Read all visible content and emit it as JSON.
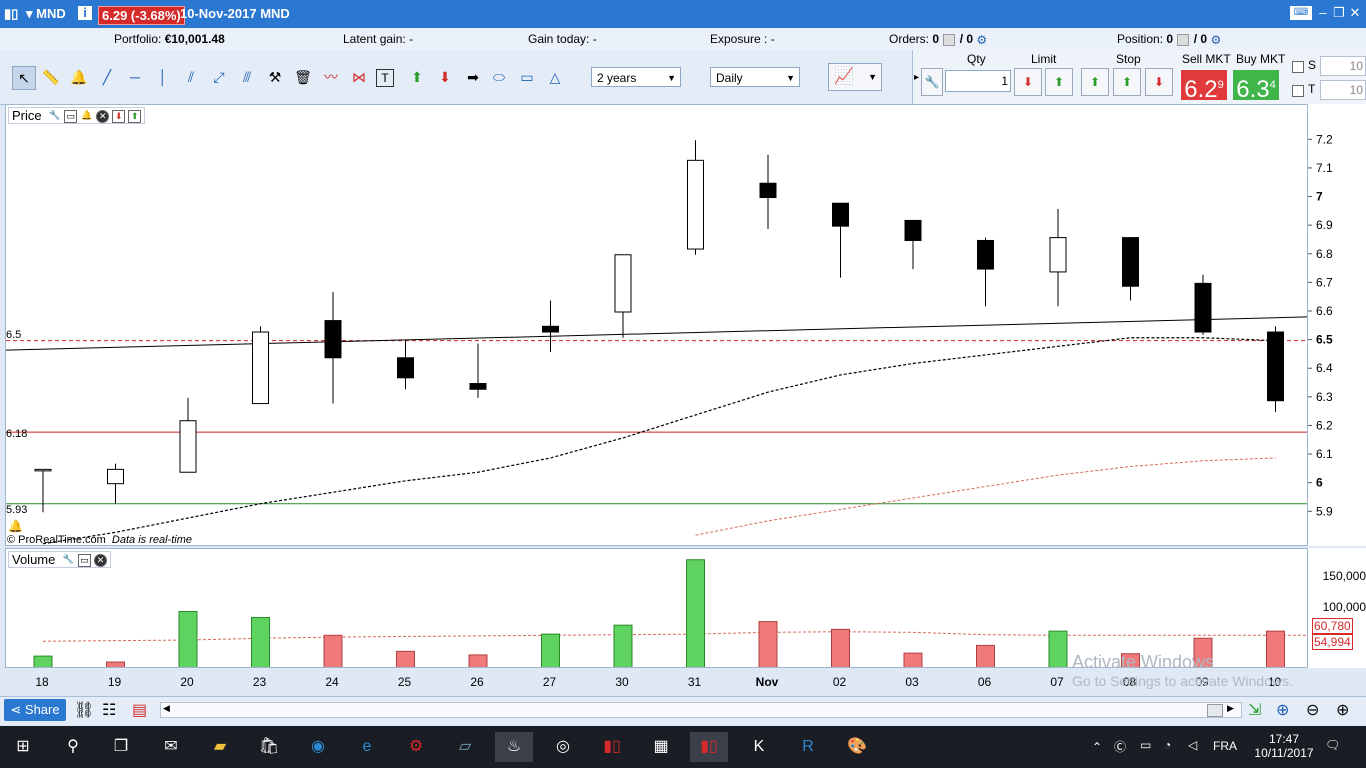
{
  "title_bar": {
    "symbol": "MND",
    "price_change": "6.29 (-3.68%)",
    "date_symbol": "10-Nov-2017 MND"
  },
  "portfolio_row": {
    "portfolio_label": "Portfolio:",
    "portfolio_value": "€10,001.48",
    "latent_label": "Latent gain:",
    "latent_value": "-",
    "today_label": "Gain today:",
    "today_value": "-",
    "exposure_label": "Exposure :",
    "exposure_value": "-",
    "orders_label": "Orders:",
    "orders_value": "0",
    "orders_value2": "/ 0",
    "position_label": "Position:",
    "position_value": "0",
    "position_value2": "/ 0"
  },
  "toolbar": {
    "period": "2 years",
    "interval": "Daily"
  },
  "trade_panel": {
    "qty_label": "Qty",
    "qty_value": "1",
    "limit_label": "Limit",
    "stop_label": "Stop",
    "sell_label": "Sell MKT",
    "sell_price": "6.2",
    "sell_sup": "9",
    "buy_label": "Buy MKT",
    "buy_price": "6.3",
    "buy_sup": "4",
    "s_label": "S",
    "s_value": "10",
    "t_label": "T",
    "t_value": "10"
  },
  "price_panel": {
    "title": "Price",
    "label_65": "6.5",
    "label_618": "6.18",
    "label_593": "5.93",
    "credit": "© ProRealTime.com",
    "realtime": "Data is real-time",
    "axis_ticks": [
      "7.2",
      "7.1",
      "7",
      "6.9",
      "6.8",
      "6.7",
      "6.6",
      "6.5",
      "6.4",
      "6.3",
      "6.2",
      "6.1",
      "6",
      "5.9"
    ]
  },
  "volume_panel": {
    "title": "Volume",
    "axis_ticks": [
      "150,000",
      "100,000"
    ],
    "ma_value_1": "60,780",
    "ma_value_2": "54,994"
  },
  "x_labels": [
    "18",
    "19",
    "20",
    "23",
    "24",
    "25",
    "26",
    "27",
    "30",
    "31",
    "Nov",
    "02",
    "03",
    "06",
    "07",
    "08",
    "09",
    "10"
  ],
  "footer": {
    "share": "Share"
  },
  "watermark": {
    "line1": "Activate Windows",
    "line2": "Go to Settings to activate Windows."
  },
  "taskbar": {
    "lang": "FRA",
    "time": "17:47",
    "date": "10/11/2017"
  },
  "chart_data": {
    "type": "candlestick",
    "categories": [
      "18",
      "19",
      "20",
      "23",
      "24",
      "25",
      "26",
      "27",
      "30",
      "31",
      "Nov",
      "02",
      "03",
      "06",
      "07",
      "08",
      "09",
      "10"
    ],
    "open": [
      6.05,
      6.0,
      6.04,
      6.28,
      6.57,
      6.44,
      6.35,
      6.55,
      6.6,
      6.82,
      7.05,
      6.98,
      6.92,
      6.85,
      6.74,
      6.86,
      6.7,
      6.53
    ],
    "high": [
      6.05,
      6.07,
      6.3,
      6.55,
      6.67,
      6.5,
      6.49,
      6.64,
      6.8,
      7.2,
      7.15,
      6.98,
      6.92,
      6.86,
      6.96,
      6.86,
      6.73,
      6.55
    ],
    "low": [
      5.9,
      5.93,
      6.04,
      6.28,
      6.28,
      6.33,
      6.3,
      6.46,
      6.51,
      6.8,
      6.89,
      6.72,
      6.75,
      6.62,
      6.62,
      6.64,
      6.52,
      6.25
    ],
    "close": [
      6.05,
      6.05,
      6.22,
      6.53,
      6.44,
      6.37,
      6.33,
      6.53,
      6.8,
      7.13,
      7.0,
      6.9,
      6.85,
      6.75,
      6.86,
      6.69,
      6.53,
      6.29
    ],
    "y_range": [
      5.85,
      7.25
    ],
    "hlines": [
      {
        "value": 6.5,
        "label": "6.5",
        "style": "dashed",
        "color": "#cc2222"
      },
      {
        "value": 6.18,
        "label": "6.18",
        "style": "solid",
        "color": "#cc2222"
      },
      {
        "value": 5.93,
        "label": "5.93",
        "style": "solid",
        "color": "#2b8a2b"
      }
    ],
    "trendline": {
      "from": [
        0,
        6.47
      ],
      "to": [
        17,
        6.58
      ]
    },
    "ma_short": [
      5.79,
      5.83,
      5.88,
      5.93,
      5.97,
      6.01,
      6.04,
      6.09,
      6.16,
      6.24,
      6.32,
      6.38,
      6.42,
      6.45,
      6.48,
      6.51,
      6.51,
      6.5
    ],
    "ma_long_start": 9,
    "ma_long": [
      5.82,
      5.87,
      5.91,
      5.95,
      5.99,
      6.03,
      6.06,
      6.08,
      6.09
    ],
    "volume": {
      "values": [
        20000,
        10000,
        95000,
        85000,
        55000,
        28000,
        22000,
        57000,
        72000,
        182000,
        78000,
        65000,
        25000,
        38000,
        62000,
        24000,
        50000,
        62000
      ],
      "direction": [
        "up",
        "down",
        "up",
        "up",
        "down",
        "down",
        "down",
        "up",
        "up",
        "up",
        "down",
        "down",
        "down",
        "down",
        "up",
        "down",
        "down",
        "down"
      ],
      "y_range": [
        0,
        190000
      ],
      "ma_values": [
        45000,
        46000,
        47000,
        50000,
        52000,
        53000,
        54000,
        55000,
        56000,
        57000,
        60000,
        61000,
        60000,
        56000,
        55000,
        55000,
        55000,
        55000
      ]
    },
    "colors": {
      "up_volume": "#5fd35f",
      "down_volume": "#f07a7a",
      "bear_candle": "#000000",
      "bull_candle": "#ffffff"
    }
  }
}
